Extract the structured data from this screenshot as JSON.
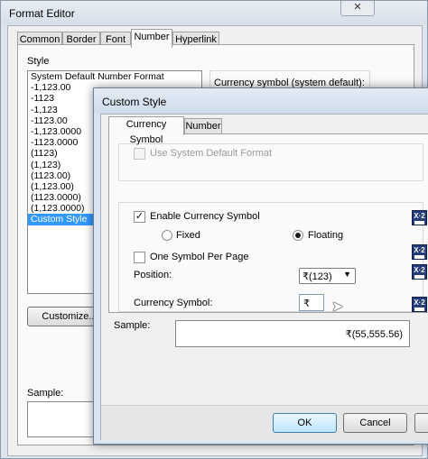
{
  "format_editor": {
    "title": "Format Editor",
    "close_glyph": "✕",
    "tabs": [
      "Common",
      "Border",
      "Font",
      "Number",
      "Hyperlink"
    ],
    "selected_tab": "Number",
    "style_label": "Style",
    "styles": [
      "System Default Number Format",
      "-1,123.00",
      "-1123",
      "-1,123",
      "-1123.00",
      "-1,123.0000",
      "-1123.0000",
      "(1123)",
      "(1,123)",
      "(1123.00)",
      "(1,123.00)",
      "(1123.0000)",
      "(1,123.0000)",
      "Custom Style"
    ],
    "selected_style": "Custom Style",
    "currency_symbol_default_label": "Currency symbol (system default):",
    "customize_button": "Customize...",
    "sample_label": "Sample:"
  },
  "custom_style": {
    "title": "Custom Style",
    "tabs": [
      "Currency Symbol",
      "Number"
    ],
    "selected_tab": "Currency Symbol",
    "use_system_default": {
      "label": "Use System Default Format",
      "checked": false,
      "enabled": false
    },
    "enable_currency_symbol": {
      "label": "Enable Currency Symbol",
      "checked": true
    },
    "placement": {
      "options": [
        "Fixed",
        "Floating"
      ],
      "selected": "Floating"
    },
    "one_symbol_per_page": {
      "label": "One Symbol Per Page",
      "checked": false
    },
    "position": {
      "label": "Position:",
      "value": "₹(123)"
    },
    "currency_symbol": {
      "label": "Currency Symbol:",
      "value": "₹"
    },
    "sample": {
      "label": "Sample:",
      "value": "₹(55,555.56)"
    },
    "buttons": {
      "ok": "OK",
      "cancel": "Cancel"
    },
    "x2_icon_text": "X·2",
    "colors": {
      "accent_selection": "#3399ff",
      "x2_icon": "#243d7a"
    }
  }
}
